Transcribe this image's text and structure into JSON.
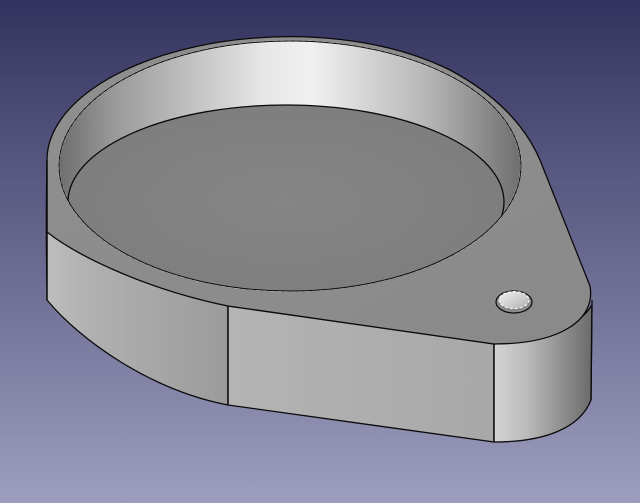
{
  "viewport": {
    "background_top_color": "#33335f",
    "background_bottom_color": "#9d9dbe",
    "edge_color": "#0a0a0a"
  },
  "model": {
    "name": "",
    "shape": "teardrop tray with circular pocket and mounting hole",
    "face_colors": {
      "top_face": "#8e8e8e",
      "pocket_floor": "#828282",
      "outer_wall_light": "#bdbdbd",
      "outer_wall_dark": "#6a6a6a",
      "hole_inner": "#e3e3e3"
    }
  }
}
